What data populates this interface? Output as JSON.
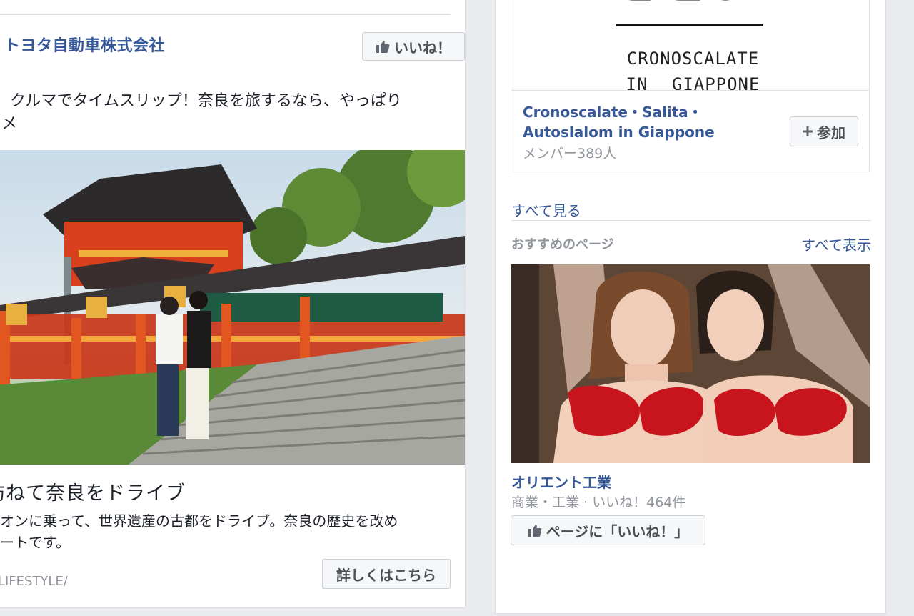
{
  "feed_post": {
    "page_name": "トヨタ自動車株式会社",
    "like_label": "いいね！",
    "text_line1": "クルマでタイムスリップ！奈良を旅するなら、やっぱり",
    "text_line2": "スメ",
    "link_title": "訪ねて奈良をドライブ",
    "link_desc_line1": "リオンに乗って、世界遺産の古都をドライブ。奈良の歴史を改め",
    "link_desc_line2": "ポートです。",
    "link_url": "P/LIFESTYLE/",
    "learn_more_label": "詳しくはこちら"
  },
  "sidebar": {
    "group": {
      "cover_line1": "CRONOSCALATE",
      "cover_line2": "IN GIAPPONE",
      "name": "Cronoscalate・Salita・Autoslalom in Giappone",
      "members": "メンバー389人",
      "join_label": "参加"
    },
    "see_all_label": "すべて見る",
    "recommended": {
      "header": "おすすめのページ",
      "show_all_label": "すべて表示",
      "page_name": "オリエント工業",
      "meta": "商業・工業 · いいね！464件",
      "like_page_label": "ページに「いいね！」"
    }
  },
  "colors": {
    "link_blue": "#365899",
    "muted_gray": "#90949c",
    "button_bg": "#f6f7f9",
    "page_bg": "#e9ebee"
  },
  "icons": [
    "thumbs-up-icon",
    "plus-icon"
  ]
}
